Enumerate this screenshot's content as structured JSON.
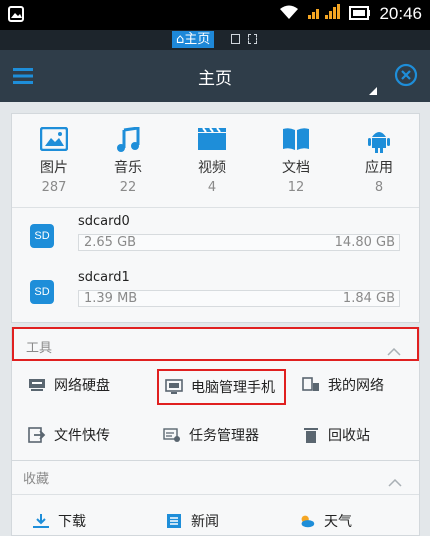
{
  "status": {
    "time": "20:46"
  },
  "path": {
    "crumb": "⌂主页"
  },
  "titlebar": {
    "title": "主页"
  },
  "categories": [
    {
      "name": "图片",
      "count": "287",
      "icon": "image-icon"
    },
    {
      "name": "音乐",
      "count": "22",
      "icon": "music-icon"
    },
    {
      "name": "视频",
      "count": "4",
      "icon": "video-icon"
    },
    {
      "name": "文档",
      "count": "12",
      "icon": "document-icon"
    },
    {
      "name": "应用",
      "count": "8",
      "icon": "android-icon"
    }
  ],
  "storage": [
    {
      "name": "sdcard0",
      "used": "2.65 GB",
      "total": "14.80 GB",
      "icon_label": "SD",
      "fill": 0.18
    },
    {
      "name": "sdcard1",
      "used": "1.39 MB",
      "total": "1.84 GB",
      "icon_label": "SD",
      "fill": 0.01
    }
  ],
  "tools": {
    "header": "工具",
    "items": [
      {
        "label": "网络硬盘",
        "icon": "network-drive-icon"
      },
      {
        "label": "电脑管理手机",
        "icon": "pc-manage-icon"
      },
      {
        "label": "我的网络",
        "icon": "my-network-icon"
      },
      {
        "label": "文件快传",
        "icon": "file-transfer-icon"
      },
      {
        "label": "任务管理器",
        "icon": "task-manager-icon"
      },
      {
        "label": "回收站",
        "icon": "recycle-bin-icon"
      }
    ]
  },
  "favorites": {
    "header": "收藏",
    "items": [
      {
        "label": "下载",
        "icon": "download-icon"
      },
      {
        "label": "新闻",
        "icon": "news-icon"
      },
      {
        "label": "天气",
        "icon": "weather-icon"
      }
    ]
  },
  "colors": {
    "accent": "#1e88d8",
    "titlebar": "#2f3d49",
    "highlight": "#e02020"
  }
}
